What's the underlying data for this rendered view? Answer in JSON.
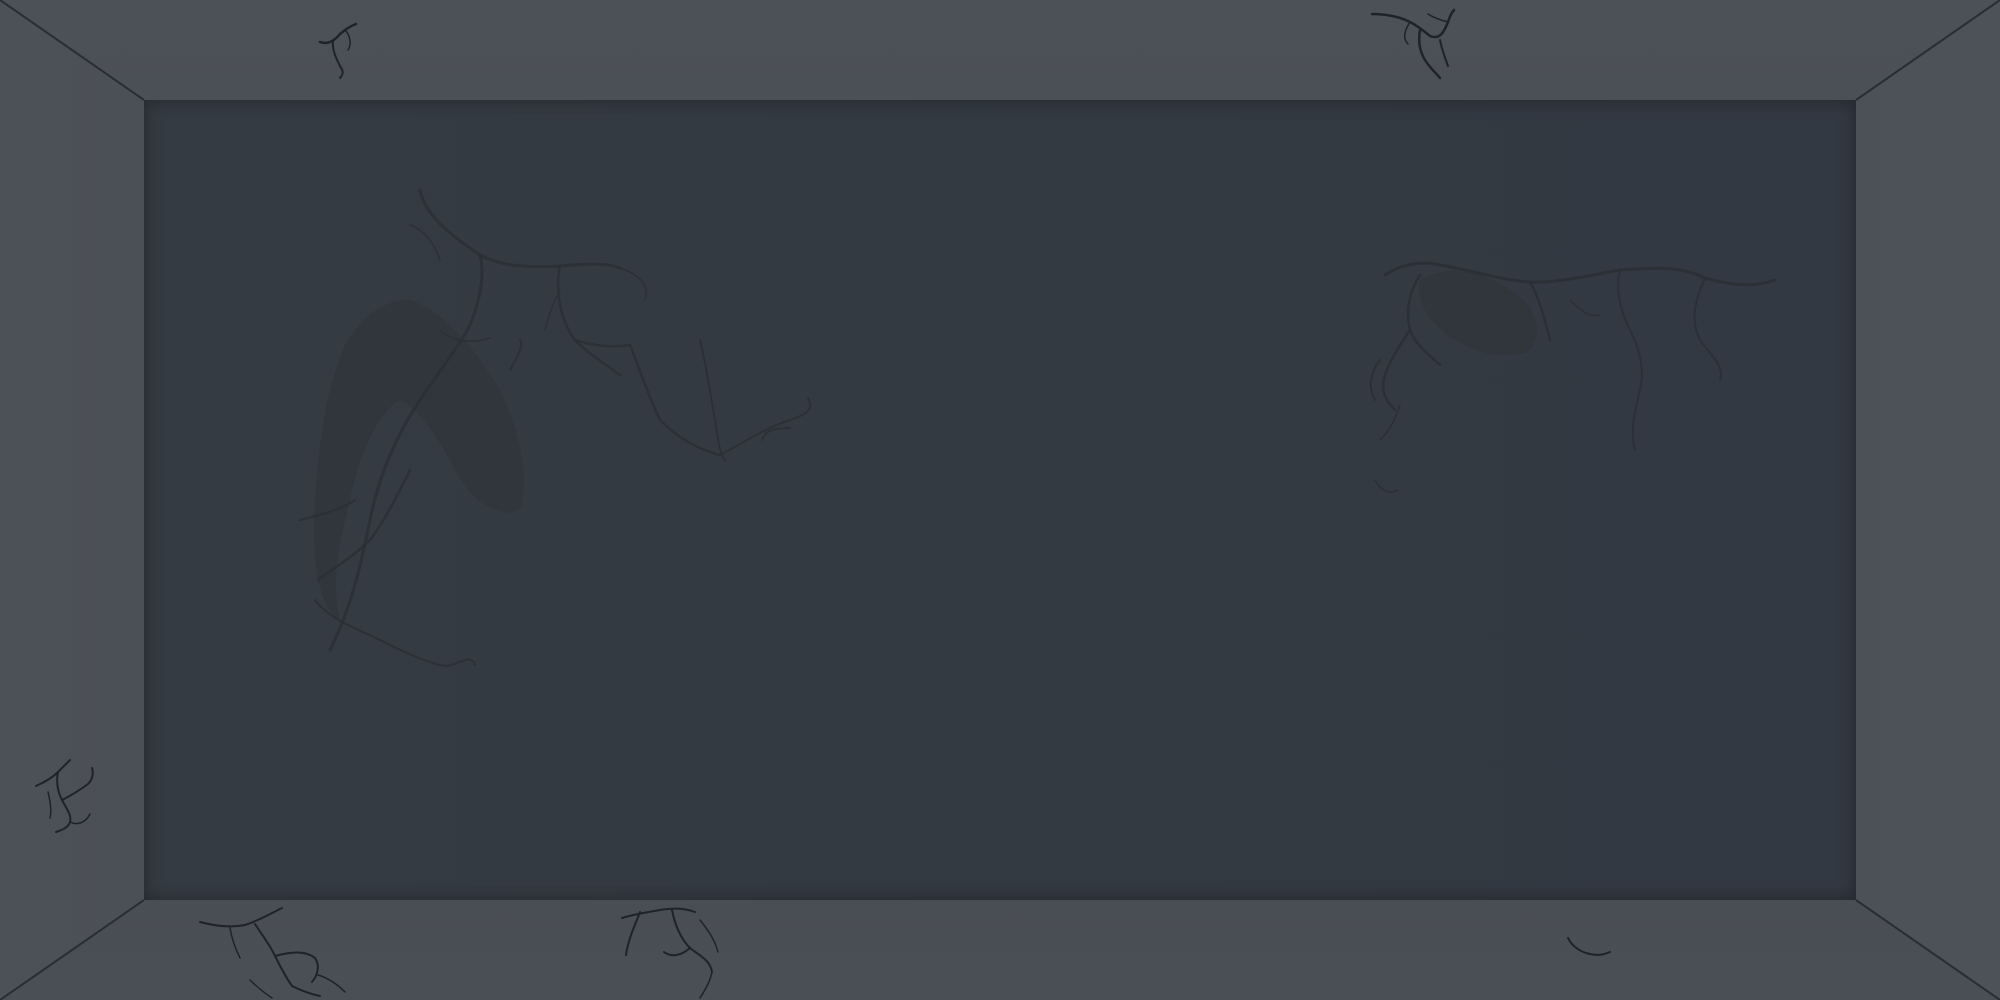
{
  "scene": {
    "type": "empty room",
    "view": "top-down",
    "floor_color": "#343a42",
    "wall_color": "#4a4f55",
    "shadow_color": "#1f2327",
    "crack_color": "#1f2327"
  }
}
